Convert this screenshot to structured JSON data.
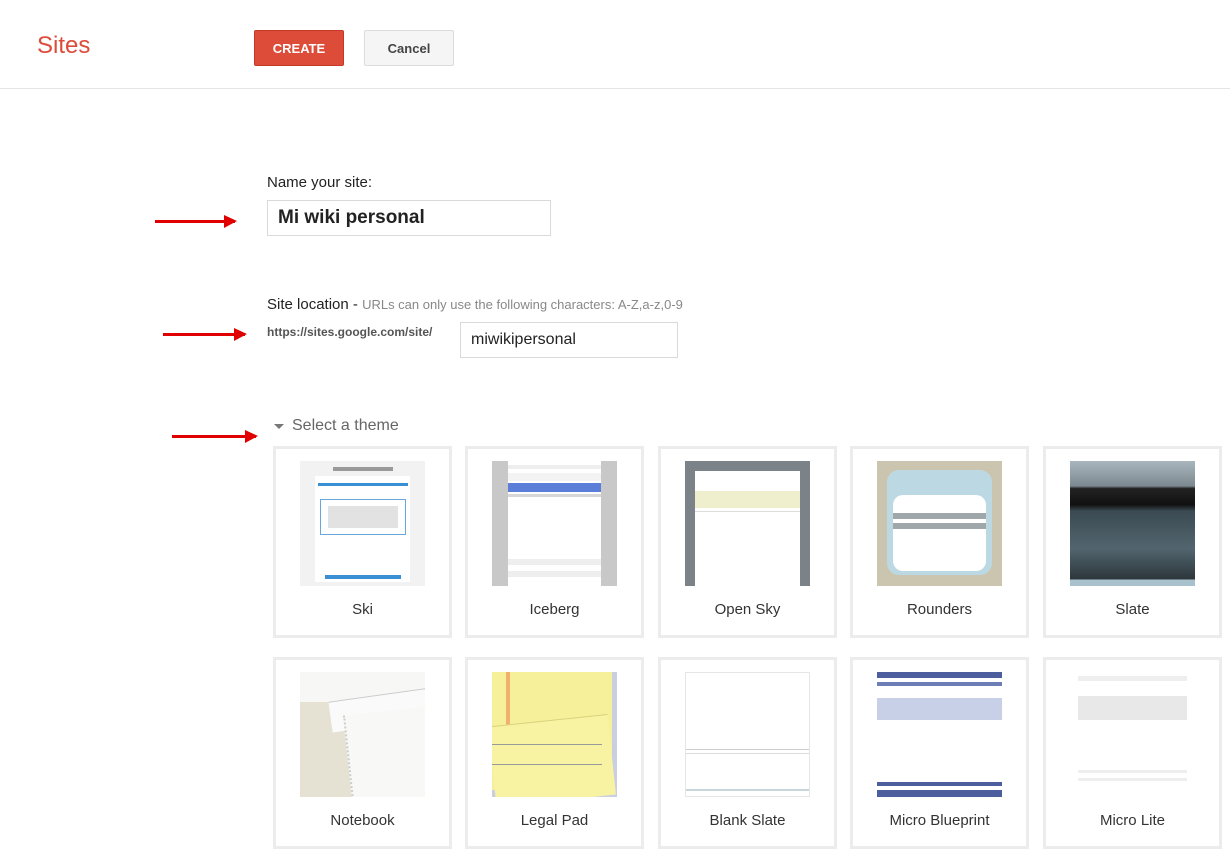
{
  "header": {
    "title": "Sites",
    "create_label": "CREATE",
    "cancel_label": "Cancel"
  },
  "form": {
    "name_label": "Name your site:",
    "name_value": "Mi wiki personal",
    "location_label": "Site location",
    "location_separator": " - ",
    "location_hint": "URLs can only use the following characters: A-Z,a-z,0-9",
    "url_prefix": "https://sites.google.com/site/",
    "location_value": "miwikipersonal"
  },
  "themes": {
    "toggle_label": "Select a theme",
    "items": [
      {
        "name": "Ski"
      },
      {
        "name": "Iceberg"
      },
      {
        "name": "Open Sky"
      },
      {
        "name": "Rounders"
      },
      {
        "name": "Slate"
      },
      {
        "name": "Notebook"
      },
      {
        "name": "Legal Pad"
      },
      {
        "name": "Blank Slate"
      },
      {
        "name": "Micro Blueprint"
      },
      {
        "name": "Micro Lite"
      }
    ]
  },
  "colors": {
    "brand": "#dd4b39",
    "create_button": "#dd4b39",
    "annotation_arrow": "#e00000"
  }
}
